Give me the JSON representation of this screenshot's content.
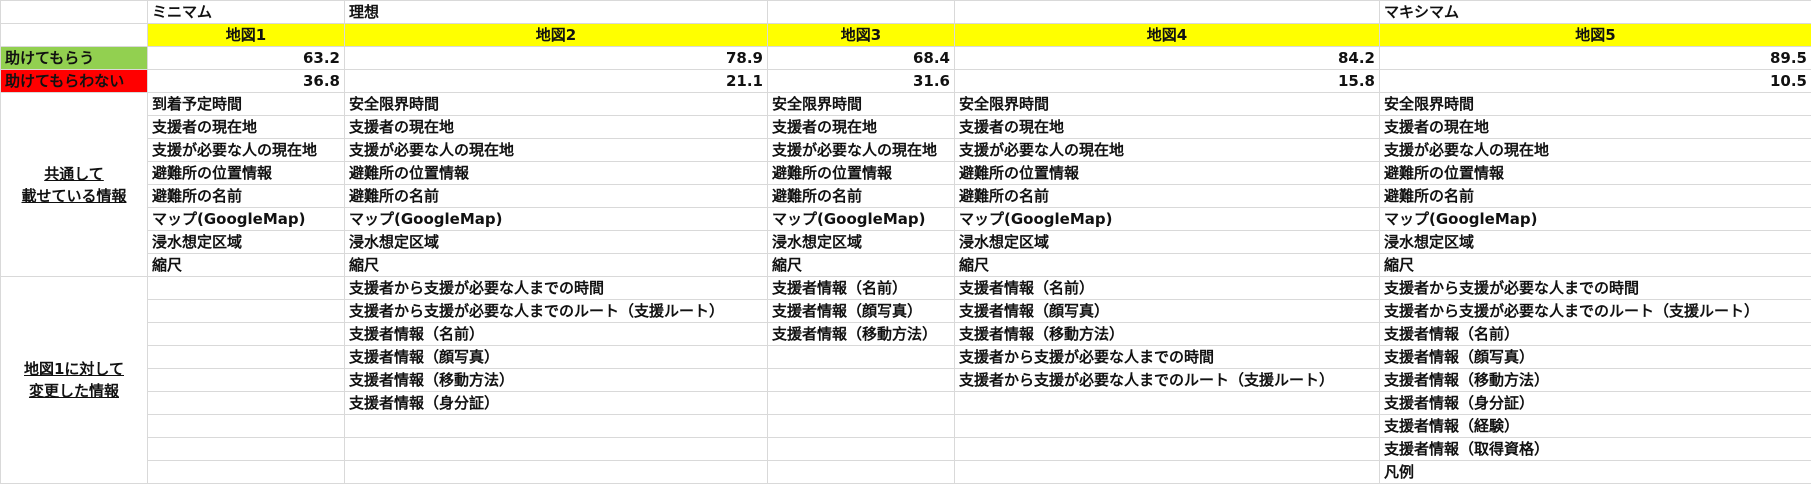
{
  "sheet": {
    "top_labels": [
      "ミニマム",
      "理想",
      "",
      "",
      "マキシマム"
    ],
    "maps": [
      "地図1",
      "地図2",
      "地図3",
      "地図4",
      "地図5"
    ],
    "help_label": "助けてもらう",
    "nohelp_label": "助けてもらわない",
    "help_values": [
      "63.2",
      "78.9",
      "68.4",
      "84.2",
      "89.5"
    ],
    "nohelp_values": [
      "36.8",
      "21.1",
      "31.6",
      "15.8",
      "10.5"
    ],
    "common_section": [
      "共通して",
      "載せている情報"
    ],
    "changed_section": [
      "地図1に対して",
      "変更した情報"
    ],
    "common_rows": [
      [
        "到着予定時間",
        "安全限界時間",
        "安全限界時間",
        "安全限界時間",
        "安全限界時間"
      ],
      [
        "支援者の現在地",
        "支援者の現在地",
        "支援者の現在地",
        "支援者の現在地",
        "支援者の現在地"
      ],
      [
        "支援が必要な人の現在地",
        "支援が必要な人の現在地",
        "支援が必要な人の現在地",
        "支援が必要な人の現在地",
        "支援が必要な人の現在地"
      ],
      [
        "避難所の位置情報",
        "避難所の位置情報",
        "避難所の位置情報",
        "避難所の位置情報",
        "避難所の位置情報"
      ],
      [
        "避難所の名前",
        "避難所の名前",
        "避難所の名前",
        "避難所の名前",
        "避難所の名前"
      ],
      [
        "マップ(GoogleMap)",
        "マップ(GoogleMap)",
        "マップ(GoogleMap)",
        "マップ(GoogleMap)",
        "マップ(GoogleMap)"
      ],
      [
        "浸水想定区域",
        "浸水想定区域",
        "浸水想定区域",
        "浸水想定区域",
        "浸水想定区域"
      ],
      [
        "縮尺",
        "縮尺",
        "縮尺",
        "縮尺",
        "縮尺"
      ]
    ],
    "changed_rows": [
      [
        "",
        "支援者から支援が必要な人までの時間",
        "支援者情報（名前）",
        "支援者情報（名前）",
        "支援者から支援が必要な人までの時間"
      ],
      [
        "",
        "支援者から支援が必要な人までのルート（支援ルート）",
        "支援者情報（顔写真）",
        "支援者情報（顔写真）",
        "支援者から支援が必要な人までのルート（支援ルート）"
      ],
      [
        "",
        "支援者情報（名前）",
        "支援者情報（移動方法）",
        "支援者情報（移動方法）",
        "支援者情報（名前）"
      ],
      [
        "",
        "支援者情報（顔写真）",
        "",
        "支援者から支援が必要な人までの時間",
        "支援者情報（顔写真）"
      ],
      [
        "",
        "支援者情報（移動方法）",
        "",
        "支援者から支援が必要な人までのルート（支援ルート）",
        "支援者情報（移動方法）"
      ],
      [
        "",
        "支援者情報（身分証）",
        "",
        "",
        "支援者情報（身分証）"
      ],
      [
        "",
        "",
        "",
        "",
        "支援者情報（経験）"
      ],
      [
        "",
        "",
        "",
        "",
        "支援者情報（取得資格）"
      ],
      [
        "",
        "",
        "",
        "",
        "凡例"
      ]
    ]
  }
}
